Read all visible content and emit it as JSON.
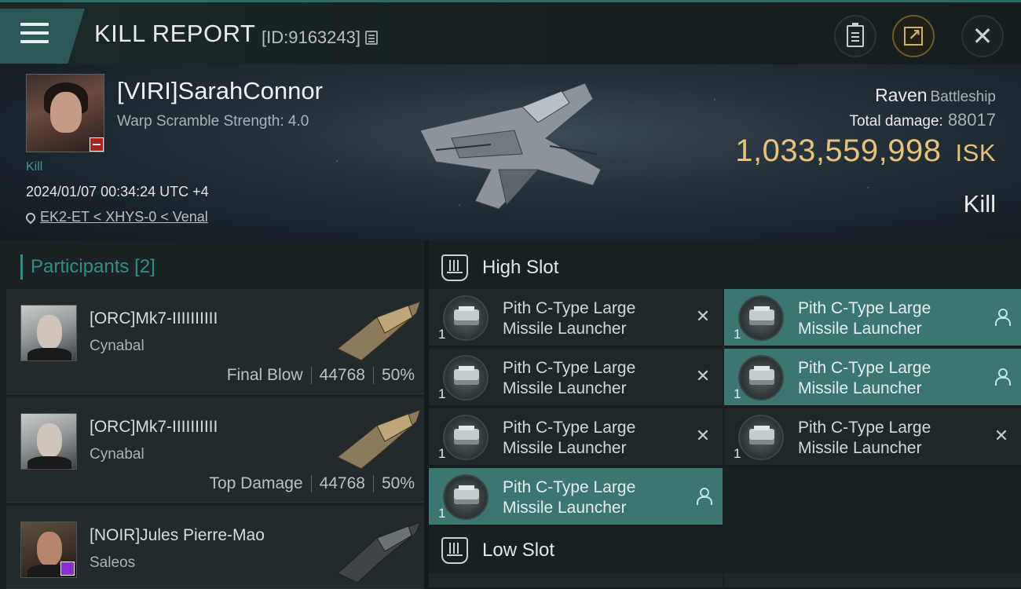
{
  "header": {
    "title": "KILL REPORT",
    "report_id": "[ID:9163243]"
  },
  "victim": {
    "name": "[VIRI]SarahConnor",
    "scramble": "Warp Scramble Strength: 4.0",
    "kill_tag": "Kill",
    "datetime": "2024/01/07 00:34:24 UTC +4",
    "location": "EK2-ET < XHYS-0 < Venal",
    "ship_name": "Raven",
    "ship_class": "Battleship",
    "total_damage_label": "Total damage:",
    "total_damage": "88017",
    "isk_value": "1,033,559,998",
    "isk_unit": "ISK",
    "result": "Kill"
  },
  "participants": {
    "title": "Participants",
    "count": "[2]",
    "rows": [
      {
        "name": "[ORC]Mk7-IIIIIIIIII",
        "ship": "Cynabal",
        "role": "Final Blow",
        "damage": "44768",
        "percent": "50%"
      },
      {
        "name": "[ORC]Mk7-IIIIIIIIII",
        "ship": "Cynabal",
        "role": "Top Damage",
        "damage": "44768",
        "percent": "50%"
      },
      {
        "name": "[NOIR]Jules Pierre-Mao",
        "ship": "Saleos"
      }
    ]
  },
  "fitting": {
    "high_slot_label": "High Slot",
    "low_slot_label": "Low Slot",
    "modules": [
      {
        "line1": "Pith C-Type Large",
        "line2": "Missile Launcher",
        "qty": "1",
        "status": "destroyed"
      },
      {
        "line1": "Pith C-Type Large",
        "line2": "Missile Launcher",
        "qty": "1",
        "status": "dropped"
      },
      {
        "line1": "Pith C-Type Large",
        "line2": "Missile Launcher",
        "qty": "1",
        "status": "destroyed"
      },
      {
        "line1": "Pith C-Type Large",
        "line2": "Missile Launcher",
        "qty": "1",
        "status": "dropped"
      },
      {
        "line1": "Pith C-Type Large",
        "line2": "Missile Launcher",
        "qty": "1",
        "status": "destroyed"
      },
      {
        "line1": "Pith C-Type Large",
        "line2": "Missile Launcher",
        "qty": "1",
        "status": "destroyed"
      },
      {
        "line1": "Pith C-Type Large",
        "line2": "Missile Launcher",
        "qty": "1",
        "status": "dropped"
      }
    ]
  },
  "icons": {
    "menu": "hamburger-icon",
    "copy": "copy-icon",
    "clipboard": "clipboard-icon",
    "share": "share-icon",
    "close": "close-icon",
    "location": "location-pin-icon",
    "slot": "slot-icon",
    "destroyed": "x-icon",
    "dropped": "person-icon"
  },
  "colors": {
    "accent_teal": "#2f8f85",
    "isk_gold": "#e7c27a",
    "highlight_row": "#3c7670"
  }
}
